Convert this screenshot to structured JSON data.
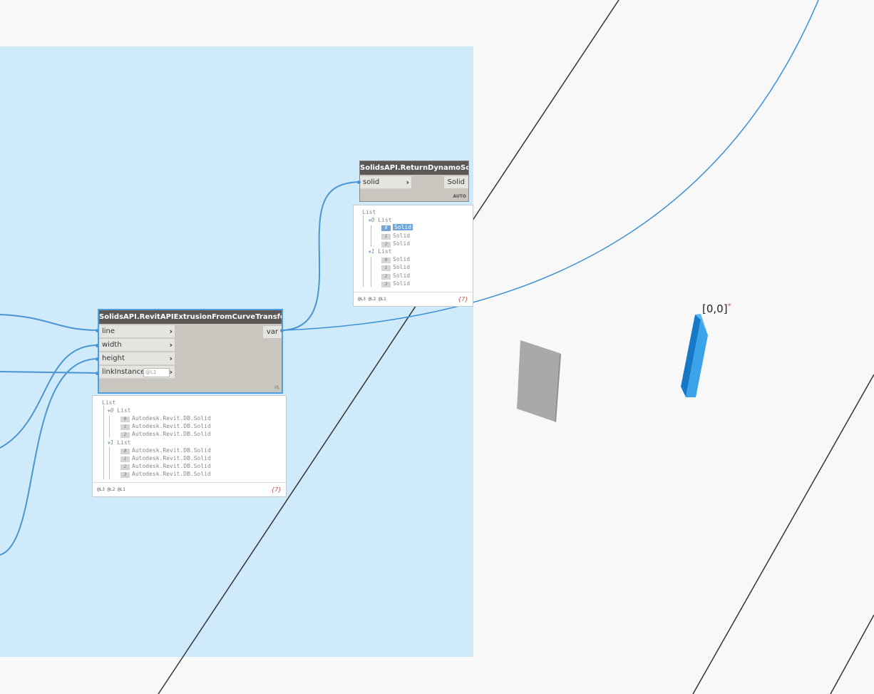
{
  "node_extrusion": {
    "title": "SolidsAPI.RevitAPIExtrusionFromCurveTransformed",
    "inputs": [
      "line",
      "width",
      "height",
      "linkInstance"
    ],
    "link_level_placeholder": "@L1",
    "output": "var",
    "lacing": "⁞⁞\\"
  },
  "node_return": {
    "title": "SolidsAPI.ReturnDynamoSolid",
    "input": "solid",
    "output": "Solid",
    "lacing": "AUTO"
  },
  "preview_extrusion": {
    "root": "List",
    "groups": [
      {
        "index": "0",
        "label": "List",
        "items": [
          {
            "i": "0",
            "v": "Autodesk.Revit.DB.Solid"
          },
          {
            "i": "1",
            "v": "Autodesk.Revit.DB.Solid"
          },
          {
            "i": "2",
            "v": "Autodesk.Revit.DB.Solid"
          }
        ]
      },
      {
        "index": "1",
        "label": "List",
        "items": [
          {
            "i": "0",
            "v": "Autodesk.Revit.DB.Solid"
          },
          {
            "i": "1",
            "v": "Autodesk.Revit.DB.Solid"
          },
          {
            "i": "2",
            "v": "Autodesk.Revit.DB.Solid"
          },
          {
            "i": "3",
            "v": "Autodesk.Revit.DB.Solid"
          }
        ]
      }
    ],
    "levels": "@L3 @L2 @L1",
    "count": "{7}"
  },
  "preview_return": {
    "root": "List",
    "groups": [
      {
        "index": "0",
        "label": "List",
        "items": [
          {
            "i": "0",
            "v": "Solid"
          },
          {
            "i": "1",
            "v": "Solid"
          },
          {
            "i": "2",
            "v": "Solid"
          }
        ]
      },
      {
        "index": "1",
        "label": "List",
        "items": [
          {
            "i": "0",
            "v": "Solid"
          },
          {
            "i": "1",
            "v": "Solid"
          },
          {
            "i": "2",
            "v": "Solid"
          },
          {
            "i": "3",
            "v": "Solid"
          }
        ]
      }
    ],
    "levels": "@L3 @L2 @L1",
    "count": "{7}"
  },
  "viewport": {
    "coordinate_label": "[0,0]",
    "star": "*"
  },
  "colors": {
    "group_background": "#cfeafb",
    "wire": "#4a95d3",
    "solid_blue": "#3aa3ea",
    "solid_gray": "#a9a9a9"
  }
}
